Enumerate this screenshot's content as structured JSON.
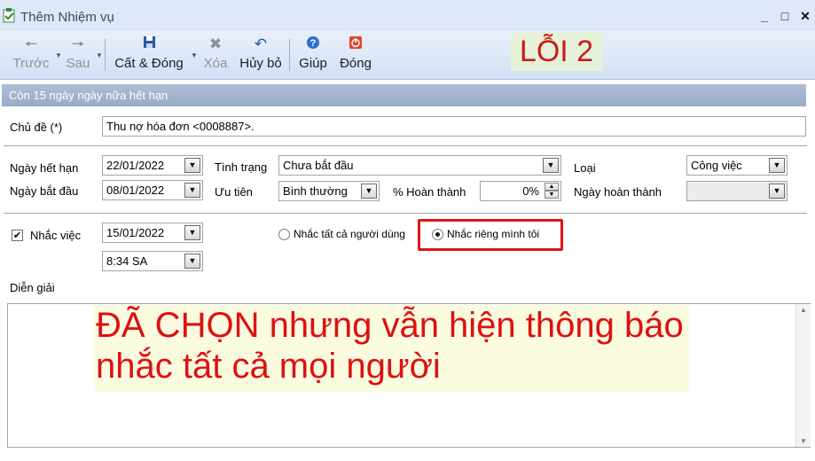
{
  "window": {
    "title": "Thêm Nhiệm vụ",
    "min_icon": "minimize-icon",
    "max_icon": "maximize-icon",
    "close_icon": "close-icon"
  },
  "toolbar": {
    "back_label": "Trước",
    "next_label": "Sau",
    "save_close_label": "Cất & Đóng",
    "delete_label": "Xóa",
    "cancel_label": "Hủy bỏ",
    "help_label": "Giúp",
    "close_label": "Đóng"
  },
  "annotation": {
    "error_tag": "LỖI 2",
    "note": "ĐÃ CHỌN nhưng vẫn hiện thông báo nhắc tất cả mọi người"
  },
  "header": {
    "status_text": "Còn 15 ngày ngày nữa hết hạn"
  },
  "form": {
    "subject_label": "Chủ đề (*)",
    "subject_value": "Thu nợ hóa đơn <0008887>.",
    "due_date_label": "Ngày hết hạn",
    "due_date_value": "22/01/2022",
    "start_date_label": "Ngày bắt đầu",
    "start_date_value": "08/01/2022",
    "status_label": "Tình trạng",
    "status_value": "Chưa bắt đầu",
    "priority_label": "Ưu tiên",
    "priority_value": "Bình thường",
    "percent_label": "% Hoàn thành",
    "percent_value": "0%",
    "type_label": "Loại",
    "type_value": "Công việc",
    "complete_date_label": "Ngày hoàn thành",
    "complete_date_value": "",
    "reminder_label": "Nhắc việc",
    "reminder_checked": true,
    "reminder_date_value": "15/01/2022",
    "reminder_time_value": "8:34 SA",
    "remind_all_label": "Nhắc tất cả người dùng",
    "remind_me_label": "Nhắc riêng mình tôi",
    "description_label": "Diễn giải"
  },
  "colors": {
    "accent_red": "#e01515",
    "note_bg": "#fbfbe0",
    "strip": "#a3b6d0"
  }
}
